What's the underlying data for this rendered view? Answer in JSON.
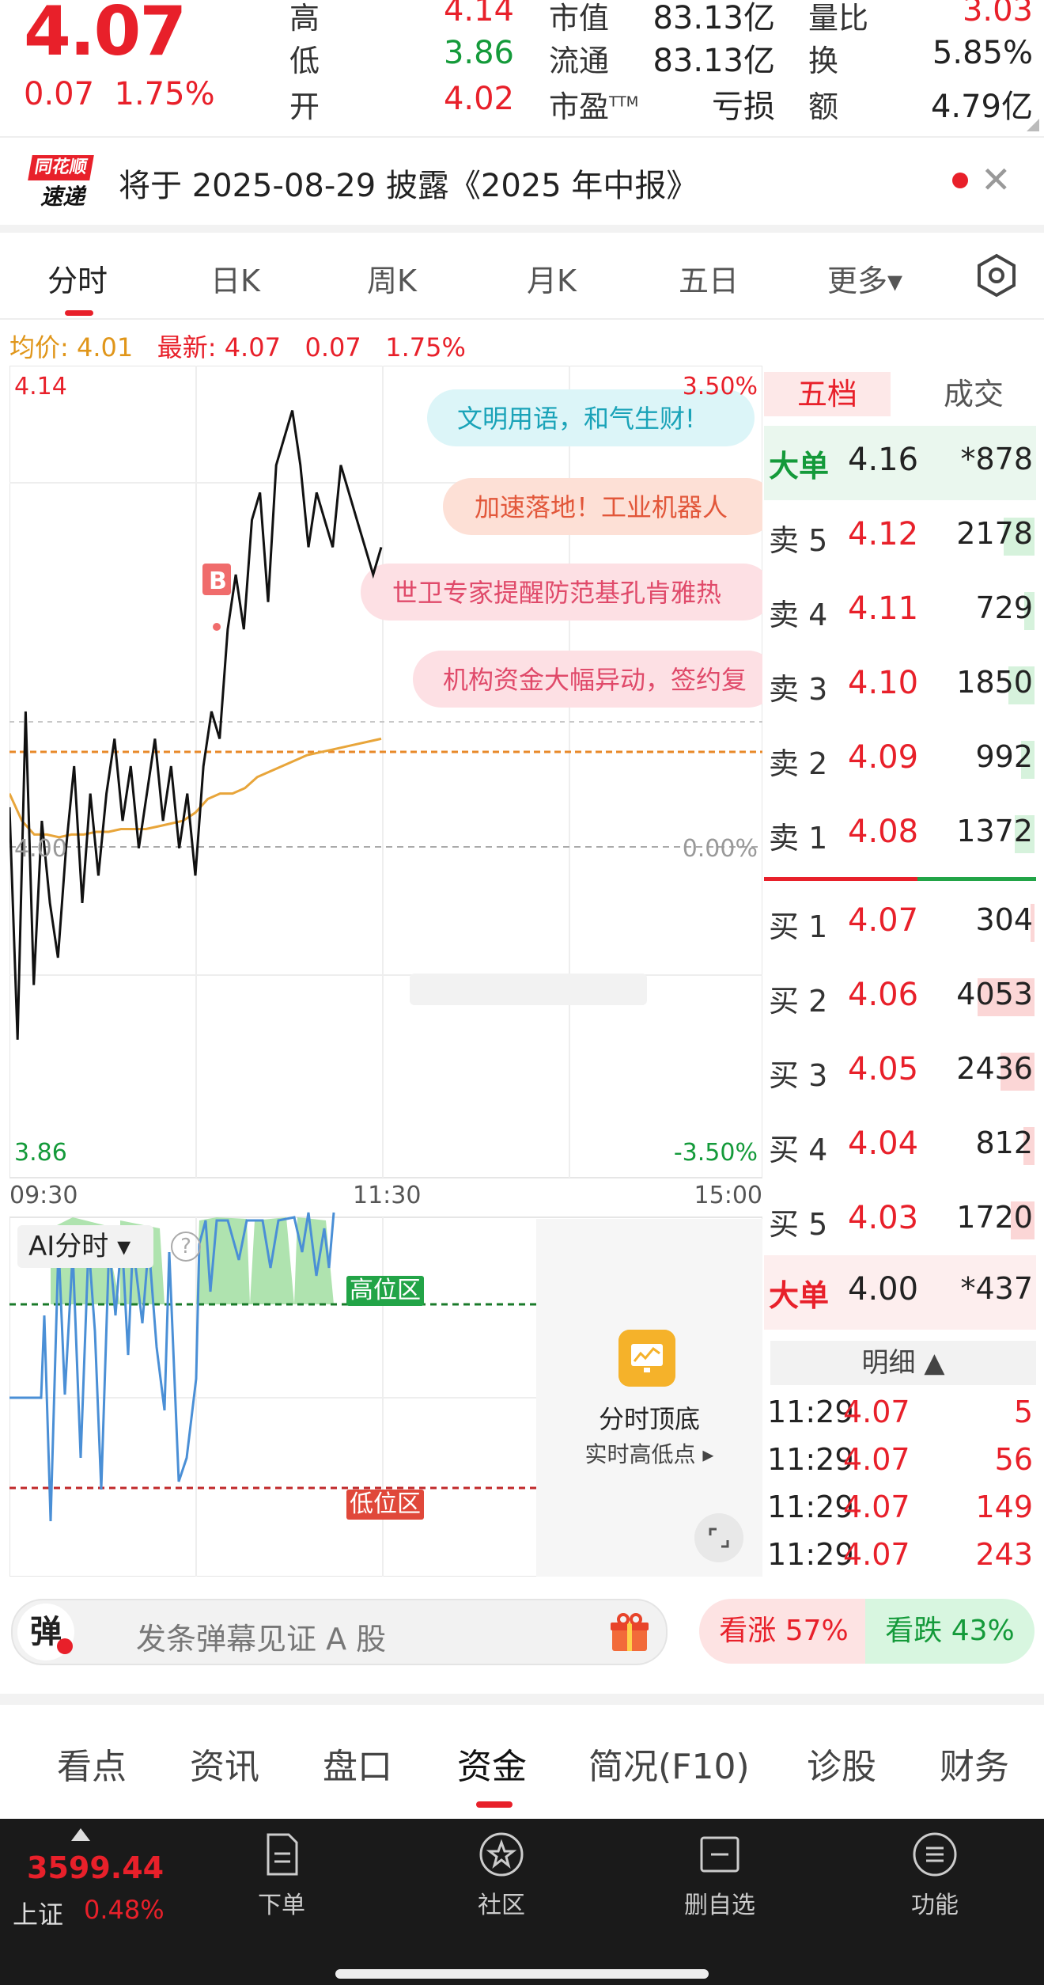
{
  "quote": {
    "price": "4.07",
    "change": "0.07",
    "change_pct": "1.75%",
    "stats": [
      {
        "key": "高",
        "value": "4.14",
        "color": "red"
      },
      {
        "key": "低",
        "value": "3.86",
        "color": "green"
      },
      {
        "key": "开",
        "value": "4.02",
        "color": "red"
      }
    ],
    "stats2": [
      {
        "key": "市值",
        "value": "83.13亿"
      },
      {
        "key": "流通",
        "value": "83.13亿"
      },
      {
        "key": "市盈",
        "sup": "TTM",
        "value": "亏损"
      }
    ],
    "stats3": [
      {
        "key": "量比",
        "value": "3.03",
        "color": "red"
      },
      {
        "key": "换",
        "value": "5.85%"
      },
      {
        "key": "额",
        "value": "4.79亿"
      }
    ]
  },
  "news": {
    "logo_top": "同花顺",
    "logo_bottom": "速递",
    "text": "将于 2025-08-29 披露《2025 年中报》"
  },
  "tabs": [
    "分时",
    "日K",
    "周K",
    "月K",
    "五日",
    "更多▾"
  ],
  "avg": {
    "avg_label": "均价: 4.01",
    "latest_label": "最新: 4.07",
    "change": "0.07",
    "pct": "1.75%"
  },
  "chart": {
    "y_high": "4.14",
    "y_low": "3.86",
    "y_mid": "4.00",
    "pct_high": "3.50%",
    "pct_mid": "0.00%",
    "pct_low": "-3.50%",
    "x_labels": [
      "09:30",
      "11:30",
      "15:00"
    ],
    "marker": "B",
    "bubbles": [
      "文明用语，和气生财!",
      "加速落地！工业机器人",
      "世卫专家提醒防范基孔肯雅热",
      "机构资金大幅异动，签约复"
    ]
  },
  "chart_data": {
    "type": "line",
    "title": "",
    "ylim": [
      3.86,
      4.14
    ],
    "series": [
      {
        "values": [
          3.985,
          3.9,
          4.02,
          3.92,
          3.98,
          3.95,
          3.93,
          3.97,
          4.0,
          3.95,
          3.99,
          3.96,
          3.99,
          4.01,
          3.98,
          4.0,
          3.97,
          3.99,
          4.01,
          3.98,
          4.0,
          3.97,
          3.99,
          3.96,
          4.0,
          4.02,
          4.01,
          4.05,
          4.07,
          4.05,
          4.09,
          4.1,
          4.06,
          4.11,
          4.12,
          4.13,
          4.11,
          4.08,
          4.1,
          4.09,
          4.08,
          4.11,
          4.1,
          4.09,
          4.08,
          4.07,
          4.08
        ]
      },
      {
        "values": [
          3.99,
          3.98,
          3.975,
          3.975,
          3.974,
          3.975,
          3.975,
          3.976,
          3.976,
          3.977,
          3.977,
          3.977,
          3.978,
          3.979,
          3.98,
          3.983,
          3.988,
          3.99,
          3.99,
          3.992,
          3.996,
          3.998,
          4.0,
          4.002,
          4.004,
          4.005,
          4.006,
          4.007,
          4.008,
          4.009,
          4.01
        ]
      }
    ]
  },
  "ai": {
    "label": "AI分时 ▾",
    "help": "?",
    "high_zone": "高位区",
    "low_zone": "低位区",
    "promo_title": "分时顶底",
    "promo_sub": "实时高低点 ▸"
  },
  "book": {
    "tab_active": "五档",
    "tab_other": "成交",
    "big_sell": {
      "key": "大单",
      "price": "4.16",
      "vol": "*878"
    },
    "asks": [
      {
        "key": "卖 5",
        "price": "4.12",
        "vol": "2178",
        "bar": 0.3
      },
      {
        "key": "卖 4",
        "price": "4.11",
        "vol": "729",
        "bar": 0.1
      },
      {
        "key": "卖 3",
        "price": "4.10",
        "vol": "1850",
        "bar": 0.25
      },
      {
        "key": "卖 2",
        "price": "4.09",
        "vol": "992",
        "bar": 0.13
      },
      {
        "key": "卖 1",
        "price": "4.08",
        "vol": "1372",
        "bar": 0.19
      }
    ],
    "bids": [
      {
        "key": "买 1",
        "price": "4.07",
        "vol": "304",
        "bar": 0.04
      },
      {
        "key": "买 2",
        "price": "4.06",
        "vol": "4053",
        "bar": 0.55
      },
      {
        "key": "买 3",
        "price": "4.05",
        "vol": "2436",
        "bar": 0.33
      },
      {
        "key": "买 4",
        "price": "4.04",
        "vol": "812",
        "bar": 0.11
      },
      {
        "key": "买 5",
        "price": "4.03",
        "vol": "1720",
        "bar": 0.23
      }
    ],
    "big_buy": {
      "key": "大单",
      "price": "4.00",
      "vol": "*437"
    },
    "detail_label": "明细 ▲",
    "details": [
      {
        "time": "11:29",
        "price": "4.07",
        "vol": "5"
      },
      {
        "time": "11:29",
        "price": "4.07",
        "vol": "56"
      },
      {
        "time": "11:29",
        "price": "4.07",
        "vol": "149"
      },
      {
        "time": "11:29",
        "price": "4.07",
        "vol": "243"
      }
    ]
  },
  "danmu": {
    "icon": "弹",
    "placeholder": "发条弹幕见证 A 股",
    "vote_up": "看涨 57%",
    "vote_down": "看跌 43%"
  },
  "bottom_tabs": [
    "看点",
    "资讯",
    "盘口",
    "资金",
    "简况(F10)",
    "诊股",
    "财务"
  ],
  "footer": {
    "index_value": "3599.44",
    "index_name": "上证",
    "index_pct": "0.48%",
    "buttons": [
      "下单",
      "社区",
      "删自选",
      "功能"
    ]
  }
}
